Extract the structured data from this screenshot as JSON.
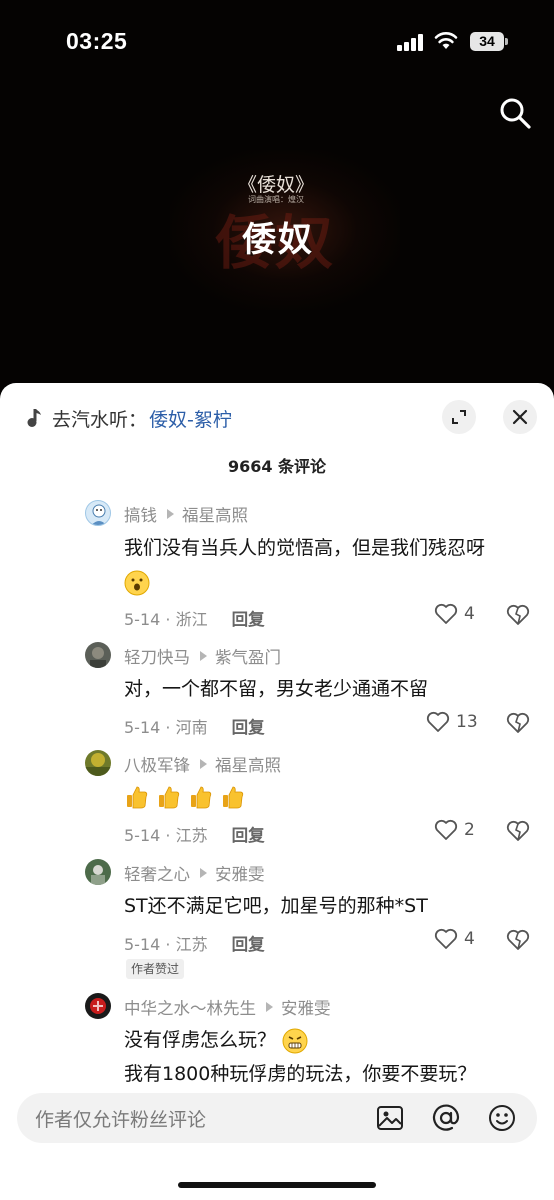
{
  "status_bar": {
    "time": "03:25",
    "battery": "34",
    "icons": [
      "cellular-signal-icon",
      "wifi-icon",
      "battery-icon"
    ]
  },
  "video": {
    "title_small": "《倭奴》",
    "credit": "词曲演唱：煌汉",
    "title_large": "倭奴",
    "title_bg": "倭奴",
    "search_icon": "search-icon"
  },
  "sheet": {
    "music_prefix": "去汽水听：",
    "music_song": "倭奴-絮柠",
    "comment_count": "9664 条评论",
    "accent_color": "#2c5ea8"
  },
  "comments": [
    {
      "user": "搞钱",
      "reply_to": "福星高照",
      "text": "我们没有当兵人的觉悟高，但是我们残忍呀",
      "emoji": "wow-face-emoji",
      "date_loc": "5-14 · 浙江",
      "reply_label": "回复",
      "likes": "4"
    },
    {
      "user": "轻刀快马",
      "reply_to": "紫气盈门",
      "text": "对，一个都不留，男女老少通通不留",
      "date_loc": "5-14 · 河南",
      "reply_label": "回复",
      "likes": "13"
    },
    {
      "user": "八极军锋",
      "reply_to": "福星高照",
      "emoji": "thumbs-up-emoji",
      "emoji_count": 4,
      "date_loc": "5-14 · 江苏",
      "reply_label": "回复",
      "likes": "2"
    },
    {
      "user": "轻奢之心",
      "reply_to": "安雅雯",
      "text": "ST还不满足它吧，加星号的那种*ST",
      "date_loc": "5-14 · 江苏",
      "reply_label": "回复",
      "likes": "4",
      "badge": "作者赞过"
    },
    {
      "user": "中华之水～林先生",
      "reply_to": "安雅雯",
      "text": "没有俘虏怎么玩？",
      "emoji": "grimace-face-emoji",
      "text2": "我有1800种玩俘虏的玩法，你要不要玩？"
    }
  ],
  "input_bar": {
    "placeholder": "作者仅允许粉丝评论",
    "icons": [
      "image-icon",
      "at-icon",
      "emoji-icon"
    ]
  }
}
